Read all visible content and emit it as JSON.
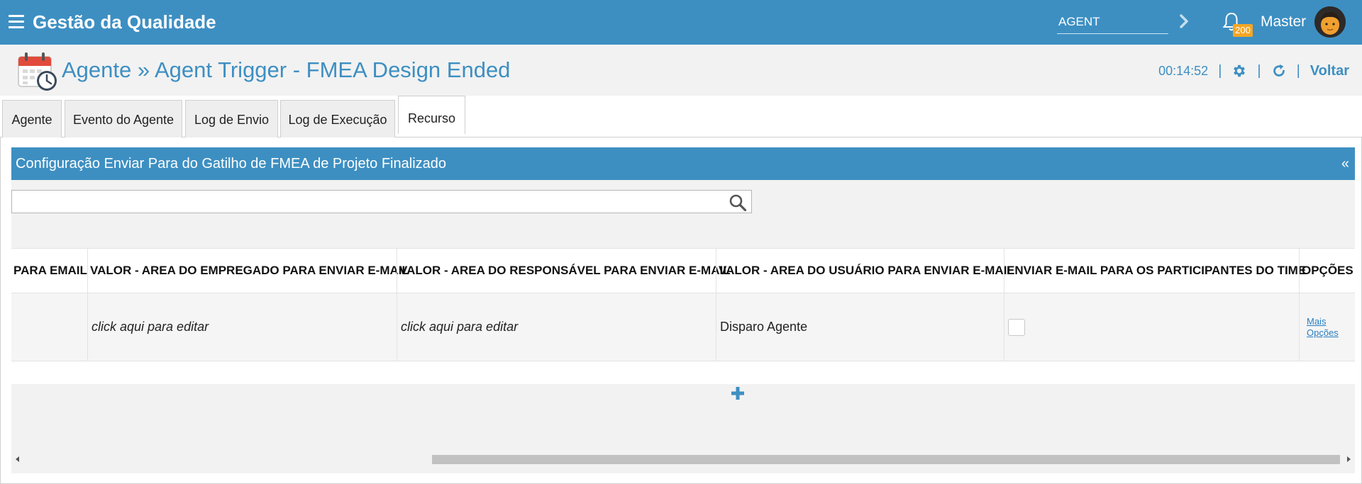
{
  "topbar": {
    "app_title": "Gestão da Qualidade",
    "agent_select_value": "AGENT",
    "notification_count": "200",
    "user_name": "Master"
  },
  "header": {
    "title": "Agente » Agent Trigger - FMEA Design Ended",
    "timer": "00:14:52",
    "separator": "|",
    "back_label": "Voltar"
  },
  "tabs": [
    {
      "label": "Agente"
    },
    {
      "label": "Evento do Agente"
    },
    {
      "label": "Log de Envio"
    },
    {
      "label": "Log de Execução"
    },
    {
      "label": "Recurso",
      "active": true
    }
  ],
  "panel": {
    "title": "Configuração Enviar Para do Gatilho de FMEA de Projeto Finalizado",
    "collapse_label": "«"
  },
  "search": {
    "value": "",
    "placeholder": ""
  },
  "table": {
    "columns": [
      "PARA EMAIL",
      "VALOR - AREA DO EMPREGADO PARA ENVIAR E-MAIL",
      "VALOR - AREA DO RESPONSÁVEL PARA ENVIAR E-MAIL",
      "VALOR - AREA DO USUÁRIO PARA ENVIAR E-MAIL",
      "ENVIAR E-MAIL PARA OS PARTICIPANTES DO TIME",
      "OPÇÕES"
    ],
    "rows": [
      {
        "para_email": "",
        "area_empregado": "click aqui para editar",
        "area_responsavel": "click aqui para editar",
        "area_usuario": "Disparo Agente",
        "enviar_participantes": false,
        "opcoes": "Mais Opções"
      }
    ]
  },
  "colors": {
    "primary": "#3d8fc2",
    "badge": "#f5a623",
    "link": "#2b7fc1"
  },
  "icons": [
    "menu-icon",
    "chevron-right-icon",
    "bell-icon",
    "avatar",
    "calendar-clock-icon",
    "gear-icon",
    "refresh-icon",
    "search-icon",
    "plus-icon"
  ]
}
